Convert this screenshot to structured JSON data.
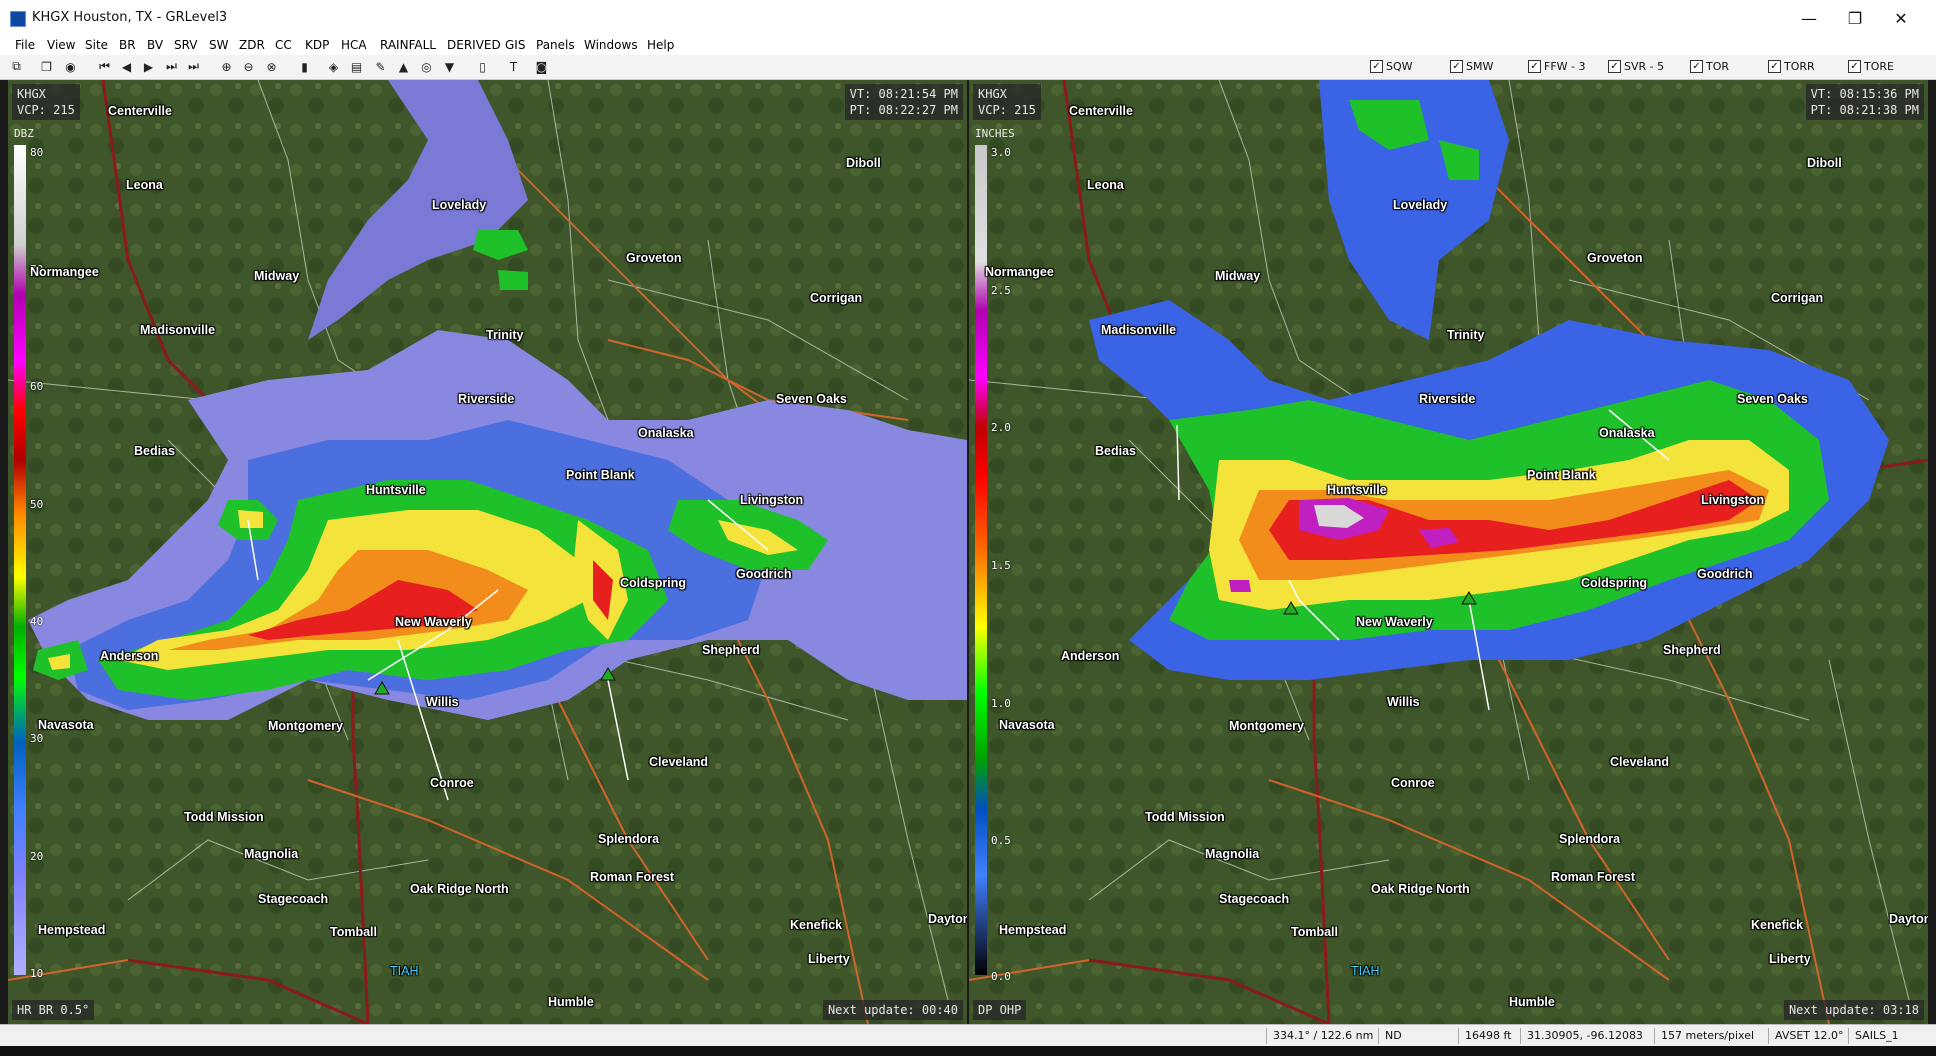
{
  "window": {
    "title": "KHGX Houston, TX - GRLevel3",
    "minimize": "—",
    "maximize": "❐",
    "close": "✕"
  },
  "menu": [
    "File",
    "View",
    "Site",
    "BR",
    "BV",
    "SRV",
    "SW",
    "ZDR",
    "CC",
    "KDP",
    "HCA",
    "RAINFALL",
    "DERIVED",
    "GIS",
    "Panels",
    "Windows",
    "Help"
  ],
  "warnings": [
    {
      "label": "SQW",
      "checked": true
    },
    {
      "label": "SMW",
      "checked": true
    },
    {
      "label": "FFW - 3",
      "checked": true
    },
    {
      "label": "SVR - 5",
      "checked": true
    },
    {
      "label": "TOR",
      "checked": true
    },
    {
      "label": "TORR",
      "checked": true
    },
    {
      "label": "TORE",
      "checked": true
    }
  ],
  "left_panel": {
    "site": "KHGX",
    "vcp": "VCP: 215",
    "vt": "VT: 08:21:54 PM",
    "pt": "PT: 08:22:27 PM",
    "scale_unit": "DBZ",
    "ticks": [
      "80",
      "70",
      "60",
      "50",
      "40",
      "30",
      "20",
      "10"
    ],
    "product": "HR BR 0.5°",
    "next_update": "Next update: 00:40"
  },
  "right_panel": {
    "site": "KHGX",
    "vcp": "VCP: 215",
    "vt": "VT: 08:15:36 PM",
    "pt": "PT: 08:21:38 PM",
    "scale_unit": "INCHES",
    "ticks": [
      "3.0",
      "2.5",
      "2.0",
      "1.5",
      "1.0",
      "0.5",
      "0.0"
    ],
    "product": "DP OHP",
    "next_update": "Next update: 03:18"
  },
  "cities": [
    "Centerville",
    "Leona",
    "Lovelady",
    "Diboll",
    "Groveton",
    "Corrigan",
    "Midway",
    "Madisonville",
    "Trinity",
    "Riverside",
    "Seven Oaks",
    "Onalaska",
    "Bedias",
    "Huntsville",
    "Point Blank",
    "Livingston",
    "Goodrich",
    "Coldspring",
    "New Waverly",
    "Anderson",
    "Shepherd",
    "Willis",
    "Navasota",
    "Montgomery",
    "Cleveland",
    "Conroe",
    "Todd Mission",
    "Magnolia",
    "Splendora",
    "Stagecoach",
    "Oak Ridge North",
    "Roman Forest",
    "Hempstead",
    "Tomball",
    "Kenefick",
    "Liberty",
    "TIAH",
    "Humble",
    "Dayton",
    "Normangee"
  ],
  "status": {
    "bearing": "334.1° / 122.6 nm",
    "value": "ND",
    "altitude": "16498 ft",
    "coords": "31.30905, -96.12083",
    "resolution": "157 meters/pixel",
    "avset": "AVSET 12.0°",
    "sails": "SAILS_1"
  }
}
